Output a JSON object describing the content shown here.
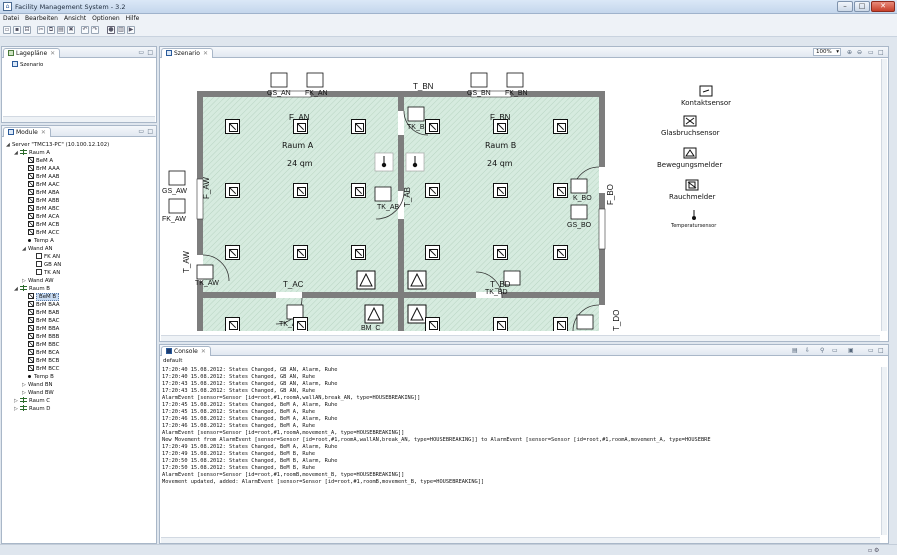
{
  "window": {
    "title": "Facility Management System - 3.2",
    "controls": [
      "minimize",
      "maximize",
      "close"
    ]
  },
  "menu": [
    "Datei",
    "Bearbeiten",
    "Ansicht",
    "Optionen",
    "Hilfe"
  ],
  "lageplaene": {
    "tab_label": "Lagepläne",
    "item": "Szenario"
  },
  "module": {
    "tab_label": "Module",
    "server": "Server \"TMC13-PC\" (10.100.12.102)",
    "raum_a": {
      "label": "Raum A",
      "sensors": [
        "BeM A",
        "BrM AAA",
        "BrM AAB",
        "BrM AAC",
        "BrM ABA",
        "BrM ABB",
        "BrM ABC",
        "BrM ACA",
        "BrM ACB",
        "BrM ACC"
      ],
      "temp": "Temp A",
      "wand_an": "Wand AN",
      "wand_an_children": [
        "FK AN",
        "GB AN",
        "TK AN"
      ],
      "wand_aw": "Wand AW"
    },
    "raum_b": {
      "label": "Raum B",
      "selected": "BeM B",
      "sensors": [
        "BrM BAA",
        "BrM BAB",
        "BrM BAC",
        "BrM BBA",
        "BrM BBB",
        "BrM BBC",
        "BrM BCA",
        "BrM BCB",
        "BrM BCC"
      ],
      "temp": "Temp B",
      "wand_bn": "Wand BN",
      "wand_bw": "Wand BW"
    },
    "raum_c": "Raum C",
    "raum_d": "Raum D"
  },
  "editor": {
    "tab_label": "Szenario",
    "zoom": "100%"
  },
  "plan": {
    "room_a": "Raum A",
    "room_b": "Raum B",
    "area_a": "24 qm",
    "area_b": "24 qm",
    "walls": [
      "F_AN",
      "F_BN",
      "T_BN",
      "T_AC",
      "T_BD",
      "F_AW",
      "T_AB",
      "T_AW",
      "F_BO",
      "T_DO"
    ],
    "devices": [
      "GS_AN",
      "FK_AN",
      "GS_BN",
      "FK_BN",
      "TK_BN",
      "GS_AW",
      "FK_AW",
      "TK_AB",
      "K_BO",
      "GS_BO",
      "TK_AW",
      "TK_BD",
      "TK_AC",
      "BM_C",
      "K_DO",
      "BM_A",
      "BM_B"
    ],
    "marks": [
      "D",
      "N",
      "M",
      "E"
    ]
  },
  "legend": [
    {
      "label": "Kontaktsensor",
      "icon": "contact-sensor-icon"
    },
    {
      "label": "Glasbruchsensor",
      "icon": "glass-break-sensor-icon"
    },
    {
      "label": "Bewegungsmelder",
      "icon": "motion-sensor-icon"
    },
    {
      "label": "Rauchmelder",
      "icon": "smoke-detector-icon"
    },
    {
      "label": "Temperatursensor",
      "icon": "temperature-sensor-icon"
    }
  ],
  "console": {
    "tab_label": "Console",
    "sub_label": "default",
    "lines": [
      "17:20:40 15.08.2012: States Changed, GB AN, Alarm, Ruhe",
      "17:20:40 15.08.2012: States Changed, GB AN, Ruhe",
      "17:20:43 15.08.2012: States Changed, GB AN, Alarm, Ruhe",
      "17:20:43 15.08.2012: States Changed, GB AN, Ruhe",
      "AlarmEvent [sensor=Sensor [id=root,#1,roomA,wallAN,break_AN, type=HOUSEBREAKING]]",
      "17:20:45 15.08.2012: States Changed, BeM A, Alarm, Ruhe",
      "17:20:45 15.08.2012: States Changed, BeM A, Ruhe",
      "17:20:46 15.08.2012: States Changed, BeM A, Alarm, Ruhe",
      "17:20:46 15.08.2012: States Changed, BeM A, Ruhe",
      "AlarmEvent [sensor=Sensor [id=root,#1,roomA,movement_A, type=HOUSEBREAKING]]",
      "New Movement from AlarmEvent [sensor=Sensor [id=root,#1,roomA,wallAN,break_AN, type=HOUSEBREAKING]] to AlarmEvent [sensor=Sensor [id=root,#1,roomA,movement_A, type=HOUSEBRE",
      "17:20:49 15.08.2012: States Changed, BeM A, Alarm, Ruhe",
      "17:20:49 15.08.2012: States Changed, BeM B, Ruhe",
      "17:20:50 15.08.2012: States Changed, BeM B, Alarm, Ruhe",
      "17:20:50 15.08.2012: States Changed, BeM B, Ruhe",
      "AlarmEvent [sensor=Sensor [id=root,#1,roomB,movement_B, type=HOUSEBREAKING]]",
      "Movement updated, added: AlarmEvent [sensor=Sensor [id=root,#1,roomB,movement_B, type=HOUSEBREAKING]]"
    ]
  },
  "colors": {
    "room_fill": "#d6ebdf",
    "wall": "#7d7d7d",
    "selection": "#c9dcf3"
  }
}
